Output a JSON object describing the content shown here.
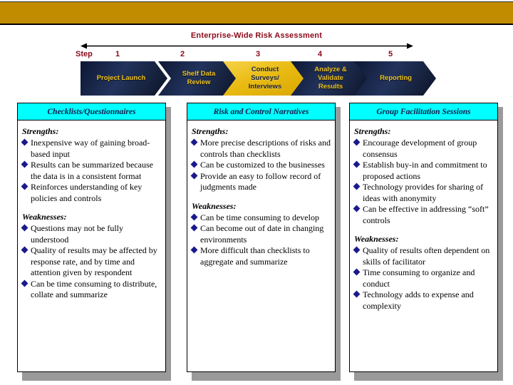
{
  "banner": {
    "color": "#c28c00"
  },
  "process": {
    "title": "Enterprise-Wide Risk Assessment",
    "step_word": "Step",
    "title_color": "#8b0a1a",
    "steps": [
      {
        "number": "1",
        "label": "Project Launch",
        "lines": [
          "Project Launch"
        ],
        "style": "dark"
      },
      {
        "number": "2",
        "label": "Shelf Data Review",
        "lines": [
          "Shelf Data",
          "Review"
        ],
        "style": "dark"
      },
      {
        "number": "3",
        "label": "Conduct Surveys/ Interviews",
        "lines": [
          "Conduct",
          "Surveys/",
          "Interviews"
        ],
        "style": "gold"
      },
      {
        "number": "4",
        "label": "Analyze & Validate Results",
        "lines": [
          "Analyze &",
          "Validate",
          "Results"
        ],
        "style": "dark"
      },
      {
        "number": "5",
        "label": "Reporting",
        "lines": [
          "Reporting"
        ],
        "style": "dark"
      }
    ],
    "colors": {
      "dark_fill": "#16234a",
      "dark_text": "#f0c420",
      "gold_fill": "#e9bb13",
      "gold_text": "#14203d"
    }
  },
  "columns": [
    {
      "header": "Checklists/Questionnaires",
      "strengths_label": "Strengths:",
      "strengths": [
        "Inexpensive way of gaining broad-based input",
        "Results can be summarized because the data is in a consistent format",
        "Reinforces understanding of key policies and controls"
      ],
      "weaknesses_label": "Weaknesses:",
      "weaknesses": [
        "Questions may not be fully understood",
        "Quality of results may be affected by response rate, and by time and attention given by respondent",
        "Can be time consuming to distribute, collate and summarize"
      ]
    },
    {
      "header": "Risk and Control Narratives",
      "strengths_label": "Strengths:",
      "strengths": [
        "More precise descriptions of risks and controls than checklists",
        "Can be customized to the businesses",
        "Provide an easy to follow record of judgments made"
      ],
      "weaknesses_label": "Weaknesses:",
      "weaknesses": [
        "Can be time consuming to develop",
        "Can become out of date in changing environments",
        "More difficult than checklists to aggregate and summarize"
      ]
    },
    {
      "header": "Group Facilitation Sessions",
      "strengths_label": "Strengths:",
      "strengths": [
        "Encourage development of group consensus",
        "Establish buy-in and commitment to proposed actions",
        "Technology provides for sharing of ideas with anonymity",
        "Can be effective in addressing “soft” controls"
      ],
      "weaknesses_label": "Weaknesses:",
      "weaknesses": [
        "Quality of results often dependent on skills of facilitator",
        "Time consuming to organize and conduct",
        "Technology adds to expense and complexity"
      ]
    }
  ],
  "theme": {
    "header_fill": "#00ffff",
    "header_text": "#0e1a4a",
    "bullet": "#1a1a8c",
    "shadow": "#9a9a9a"
  }
}
